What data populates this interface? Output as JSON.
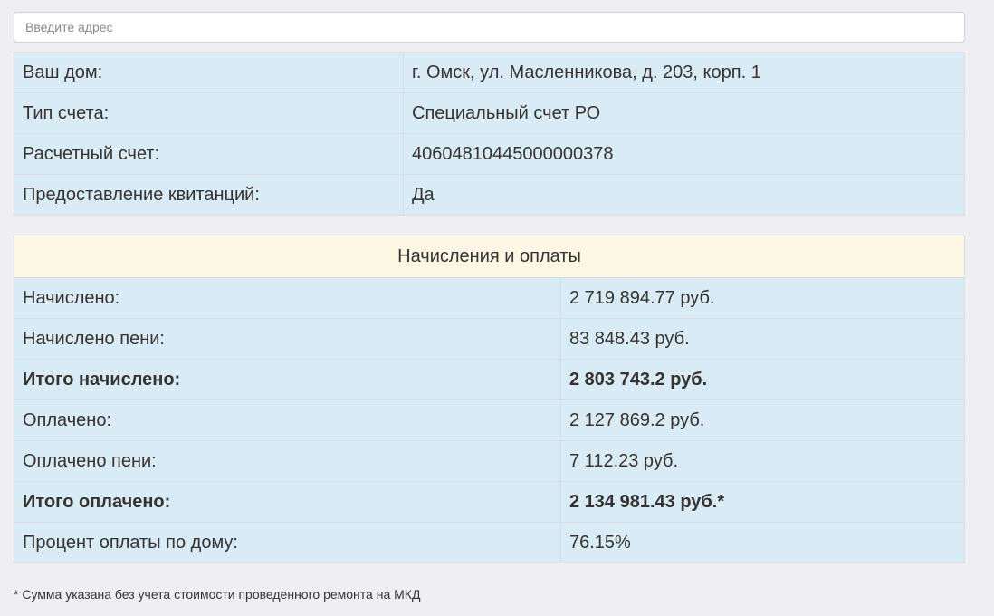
{
  "search": {
    "placeholder": "Введите адрес",
    "value": ""
  },
  "info": {
    "rows": [
      {
        "label": "Ваш дом:",
        "value": "г. Омск, ул. Масленникова, д. 203, корп. 1"
      },
      {
        "label": "Тип счета:",
        "value": "Специальный счет РО"
      },
      {
        "label": "Расчетный счет:",
        "value": "40604810445000000378"
      },
      {
        "label": "Предоставление квитанций:",
        "value": "Да"
      }
    ]
  },
  "payments": {
    "title": "Начисления и оплаты",
    "rows": [
      {
        "label": "Начислено:",
        "value": "2 719 894.77 руб."
      },
      {
        "label": "Начислено пени:",
        "value": "83 848.43 руб."
      },
      {
        "label": "Итого начислено:",
        "value": "2 803 743.2 руб."
      },
      {
        "label": "Оплачено:",
        "value": "2 127 869.2 руб."
      },
      {
        "label": "Оплачено пени:",
        "value": "7 112.23 руб."
      },
      {
        "label": "Итого оплачено:",
        "value": "2 134 981.43 руб.*"
      },
      {
        "label": "Процент оплаты по дому:",
        "value": "76.15%"
      }
    ]
  },
  "footnote": "* Сумма указана без учета стоимости проведенного ремонта на МКД"
}
